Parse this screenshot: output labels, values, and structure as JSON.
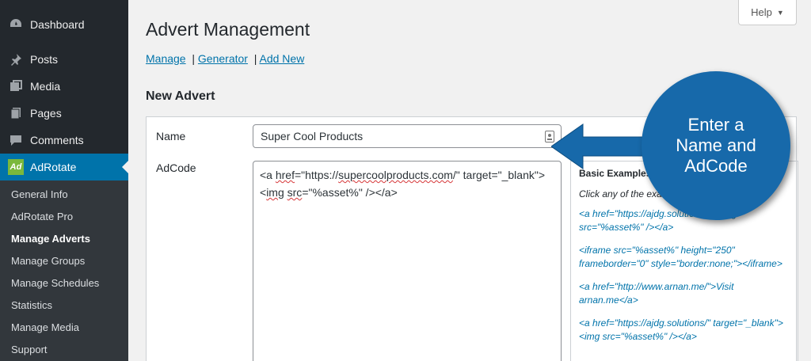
{
  "sidebar": {
    "items": [
      {
        "label": "Dashboard",
        "icon": "dashboard-icon"
      },
      {
        "label": "Posts",
        "icon": "pin-icon"
      },
      {
        "label": "Media",
        "icon": "media-icon"
      },
      {
        "label": "Pages",
        "icon": "pages-icon"
      },
      {
        "label": "Comments",
        "icon": "comments-icon"
      },
      {
        "label": "AdRotate",
        "icon": "adrotate-icon",
        "logo_text": "Ad"
      }
    ],
    "submenu": [
      "General Info",
      "AdRotate Pro",
      "Manage Adverts",
      "Manage Groups",
      "Manage Schedules",
      "Statistics",
      "Manage Media",
      "Support"
    ]
  },
  "help_tab": {
    "label": "Help"
  },
  "page": {
    "title": "Advert Management",
    "subnav": {
      "manage": "Manage",
      "generator": "Generator",
      "add_new": "Add New"
    },
    "section_title": "New Advert"
  },
  "form": {
    "name_label": "Name",
    "name_value": "Super Cool Products",
    "adcode_label": "AdCode",
    "adcode_line1_a": "<a ",
    "adcode_line1_b": "href",
    "adcode_line1_c": "=\"https://",
    "adcode_line1_d": "supercoolproducts.com",
    "adcode_line1_e": "/\" target=\"_blank\">",
    "adcode_line2_a": "img",
    "adcode_line2_b": " ",
    "adcode_line2_c": "src",
    "adcode_line2_d": "=\"%asset%\" /></a>",
    "adcode_line2_pre": "<"
  },
  "examples": {
    "heading": "Basic Examples:",
    "intro": "Click any of the examples to use it.",
    "items": [
      "<a href=\"https://ajdg.solutions/\"><img src=\"%asset%\" /></a>",
      "<iframe src=\"%asset%\" height=\"250\" frameborder=\"0\" style=\"border:none;\"></iframe>",
      "<a href=\"http://www.arnan.me/\">Visit arnan.me</a>",
      "<a href=\"https://ajdg.solutions/\" target=\"_blank\"><img src=\"%asset%\" /></a>"
    ]
  },
  "callout": {
    "line1": "Enter a",
    "line2": "Name and",
    "line3": "AdCode"
  },
  "colors": {
    "accent": "#0073aa",
    "callout": "#1769aa",
    "sidebar": "#23282d"
  }
}
